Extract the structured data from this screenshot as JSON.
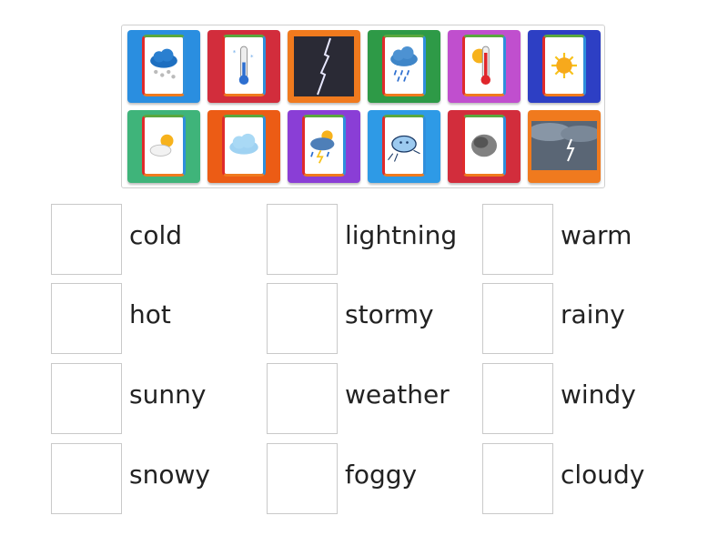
{
  "image_tiles": [
    {
      "icon": "snow-cloud-icon",
      "color": "#2a8ee0"
    },
    {
      "icon": "cold-thermometer-icon",
      "color": "#d22d3c"
    },
    {
      "icon": "lightning-photo-icon",
      "color": "#f07a1e"
    },
    {
      "icon": "rain-cloud-icon",
      "color": "#2e9a47"
    },
    {
      "icon": "hot-thermometer-icon",
      "color": "#c04fce"
    },
    {
      "icon": "sun-icon",
      "color": "#2d3fc4"
    },
    {
      "icon": "sun-cloud-icon",
      "color": "#3fb47a"
    },
    {
      "icon": "cloud-icon",
      "color": "#ec5c15"
    },
    {
      "icon": "storm-cloud-icon",
      "color": "#8a3ed6"
    },
    {
      "icon": "wind-cloud-icon",
      "color": "#2e9ae6"
    },
    {
      "icon": "fog-icon",
      "color": "#d22d3c"
    },
    {
      "icon": "stormy-sky-photo-icon",
      "color": "#f07a1e"
    }
  ],
  "labels": [
    [
      "cold",
      "lightning",
      "warm"
    ],
    [
      "hot",
      "stormy",
      "rainy"
    ],
    [
      "sunny",
      "weather",
      "windy"
    ],
    [
      "snowy",
      "foggy",
      "cloudy"
    ]
  ],
  "colors": {
    "slot_border": "#c9c9c9",
    "tray_border": "#cfcfcf",
    "frame_top": "#5aa83e",
    "frame_right": "#2f8fdc",
    "frame_bottom": "#f07a1e",
    "frame_left": "#e02b2b"
  }
}
